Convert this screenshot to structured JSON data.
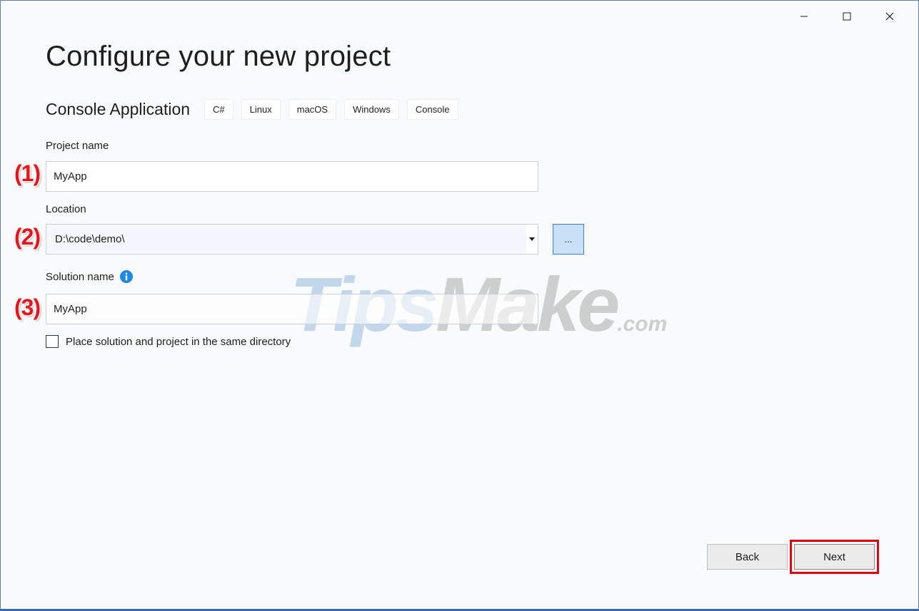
{
  "window": {
    "controls": {
      "minimize_icon": "minimize-icon",
      "maximize_icon": "maximize-icon",
      "close_icon": "close-icon"
    }
  },
  "page": {
    "title": "Configure your new project",
    "template_name": "Console Application",
    "tags": [
      "C#",
      "Linux",
      "macOS",
      "Windows",
      "Console"
    ]
  },
  "form": {
    "project_name": {
      "label": "Project name",
      "value": "MyApp"
    },
    "location": {
      "label": "Location",
      "value": "D:\\code\\demo\\",
      "browse_label": "..."
    },
    "solution_name": {
      "label": "Solution name",
      "value": "MyApp",
      "info_icon": "info-icon"
    },
    "same_directory": {
      "label": "Place solution and project in the same directory",
      "checked": false
    }
  },
  "annotations": {
    "marker_1": "(1)",
    "marker_2": "(2)",
    "marker_3": "(3)"
  },
  "watermark": {
    "tips": "Tips",
    "make": "Make",
    "domain": ".com"
  },
  "footer": {
    "back_label": "Back",
    "next_label": "Next"
  },
  "colors": {
    "accent": "#3c7fd1",
    "highlight": "#e3000f",
    "marker": "#e8141b",
    "info_icon": "#1e88e5"
  }
}
